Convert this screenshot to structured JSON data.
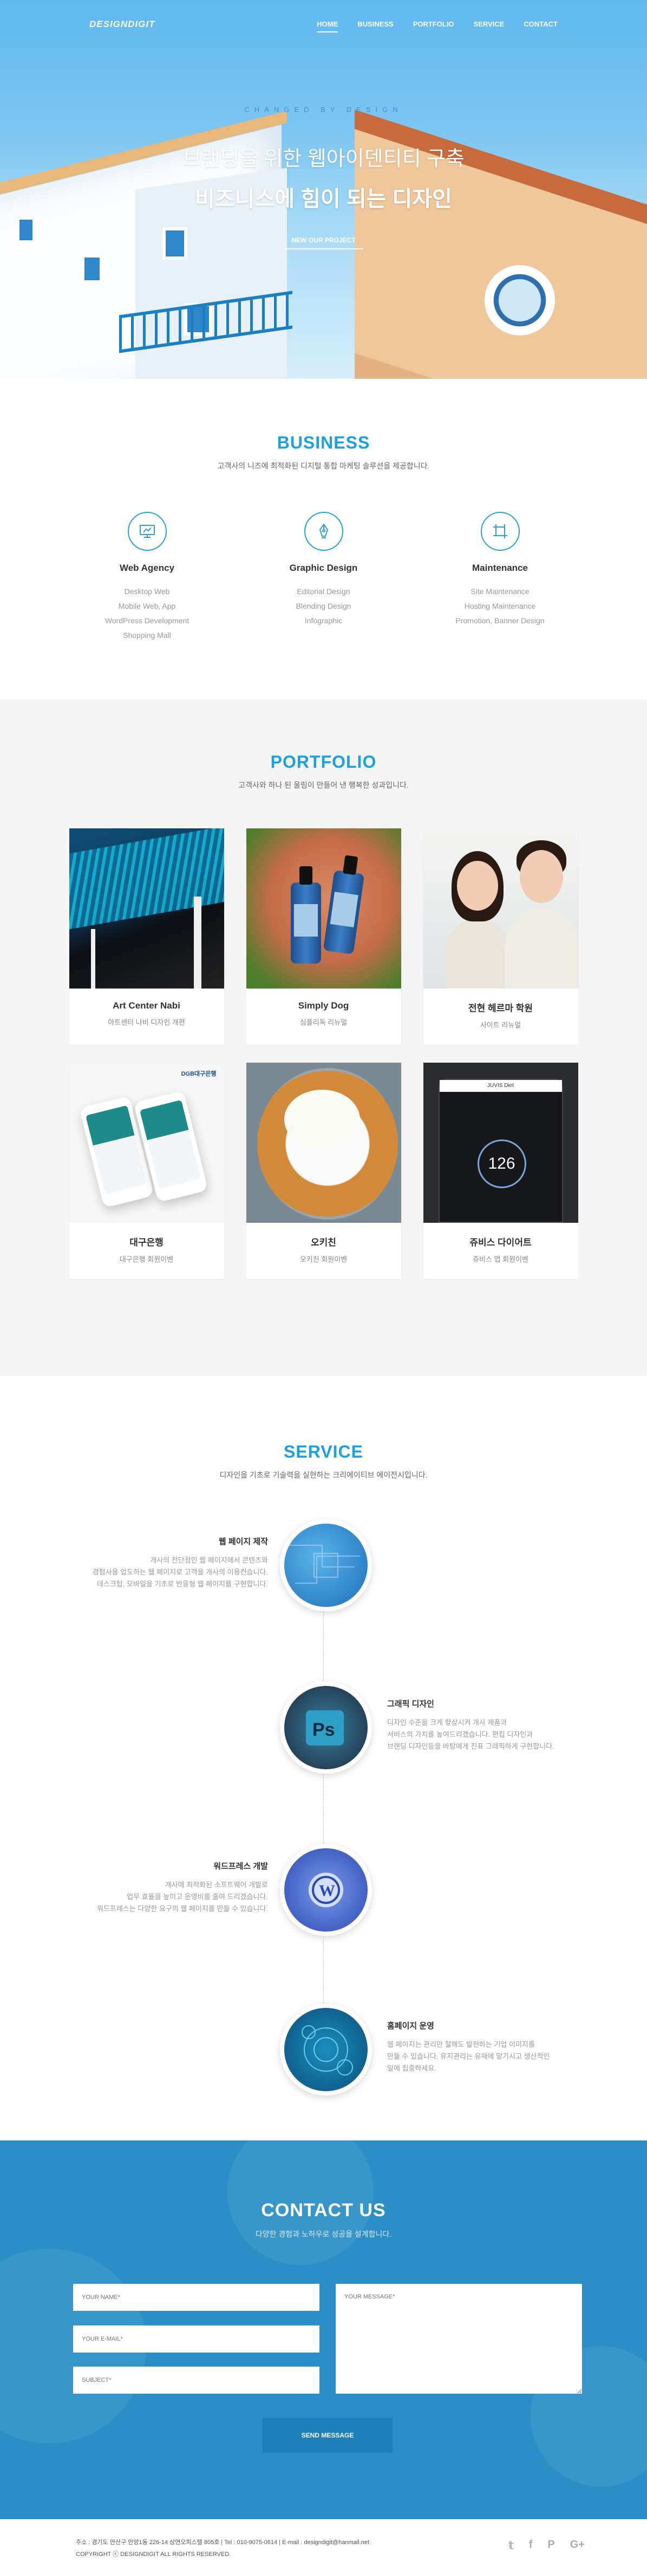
{
  "nav": {
    "logo": "DESIGNDIGIT",
    "items": [
      {
        "label": "HOME"
      },
      {
        "label": "BUSINESS"
      },
      {
        "label": "PORTFOLIO"
      },
      {
        "label": "SERVICE"
      },
      {
        "label": "CONTACT"
      }
    ]
  },
  "hero": {
    "tagline": "CHANGED BY DESIGN",
    "headline1": "브랜딩을 위한 웹아이덴티티 구축",
    "headline2": "비즈니스에 힘이 되는 디자인",
    "cta": "NEW OUR PROJECT"
  },
  "business": {
    "title": "BUSINESS",
    "subtitle": "고객사의 니즈에 최적화된 디지털 통합 마케팅 솔루션을 제공합니다.",
    "items": [
      {
        "icon": "monitor-icon",
        "name": "Web Agency",
        "lines": [
          "Desktop Web",
          "Mobile Web, App",
          "WordPress Development",
          "Shopping Mall"
        ]
      },
      {
        "icon": "pen-nib-icon",
        "name": "Graphic Design",
        "lines": [
          "Editorial Design",
          "Blending Design",
          "Infographic"
        ]
      },
      {
        "icon": "crop-icon",
        "name": "Maintenance",
        "lines": [
          "Site Maintenance",
          "Hosting Maintenance",
          "Promotion, Banner Design"
        ]
      }
    ]
  },
  "portfolio": {
    "title": "PORTFOLIO",
    "subtitle": "고객사와 하나 된 울림이 만들어 낸 행복한 성과입니다.",
    "items": [
      {
        "title": "Art Center Nabi",
        "sub": "아트센터 나비 디자인 개편"
      },
      {
        "title": "Simply Dog",
        "sub": "심플리독 리뉴얼"
      },
      {
        "title": "전현 헤르마 학원",
        "sub": "사이트 리뉴얼"
      },
      {
        "title": "대구은행",
        "sub": "대구은행 회원이벤"
      },
      {
        "title": "오키친",
        "sub": "오키친 회원이벤"
      },
      {
        "title": "쥬비스 다이어트",
        "sub": "쥬비스 앱 회원이벤"
      }
    ],
    "bank_badge": "DGB대구은행",
    "app_header": "JUVIS Diet",
    "app_value": "126"
  },
  "service": {
    "title": "SERVICE",
    "subtitle": "디자인을 기초로 기술력을 실현하는 크리에이티브 에이전시입니다.",
    "items": [
      {
        "name": "웹 페이지 제작",
        "desc": [
          "개사의 전단점인 웹 페이지에서 콘텐츠와",
          "경험사용 업도하는 웹 페이지로 고객을 개사의 이용컨습니다.",
          "데스크탑, 모바일을 기초로 반응형 웹 페이지를 구현합니다."
        ]
      },
      {
        "name": "그래픽 디자인",
        "desc": [
          "디자인 수준을 크게 향상시켜 개사 제품과",
          "서비스의 가치를 높여드리겠습니다. 편집 디자인과",
          "브랜딩 디자인등을 바탕에게 진표 그래픽하게 구현합니다."
        ]
      },
      {
        "name": "워드프레스 개발",
        "desc": [
          "개사에 최적화된 소프트웨어 개발로",
          "업무 효율을 높이고 운영비를 줄여 드리겠습니다.",
          "워드프레스는 다양한 요구의 웹 페이지를 만들 수 있습니다."
        ]
      },
      {
        "name": "홈페이지 운영",
        "desc": [
          "웹 페이지는 관리만 철해도 발전하는 기업 이미지를",
          "만들 수 있습니다. 유지관리는 유재에 맡기시고 생산적인",
          "일에 집중하세요."
        ]
      }
    ]
  },
  "contact": {
    "title": "CONTACT US",
    "subtitle": "다양한 경험과 노하우로 성공을 설계합니다.",
    "name_placeholder": "YOUR NAME*",
    "email_placeholder": "YOUR E-MAIL*",
    "subject_placeholder": "SUBJECT*",
    "message_placeholder": "YOUR MESSAGE*",
    "send_label": "SEND MESSAGE"
  },
  "footer": {
    "info": "주소 : 경기도 안산구 안양1동 226-14 상연오피스텔 805호  |  Tel : 010-9075-0614  |  E-mail : designdigit@hanmail.net",
    "copyright": "COPYRIGHT ⓒ DESIGNDIGIT ALL RIGHTS RESERVED.",
    "social": [
      "twitter-icon",
      "facebook-icon",
      "pinterest-icon",
      "google-plus-icon"
    ]
  }
}
